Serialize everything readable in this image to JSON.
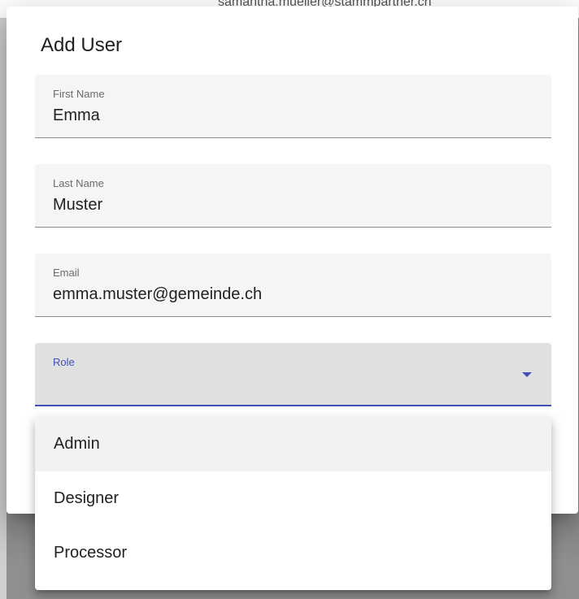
{
  "background": {
    "partial_text": "samantha.mueller@stammpartner.ch"
  },
  "dialog": {
    "title": "Add User",
    "fields": [
      {
        "label": "First Name",
        "value": "Emma"
      },
      {
        "label": "Last Name",
        "value": "Muster"
      },
      {
        "label": "Email",
        "value": "emma.muster@gemeinde.ch"
      }
    ],
    "role": {
      "label": "Role",
      "value": ""
    }
  },
  "role_menu": {
    "options": [
      "Admin",
      "Designer",
      "Processor"
    ],
    "highlighted": "Admin"
  },
  "colors": {
    "accent": "#3f51b5",
    "field_bg": "#f5f5f5",
    "focused_field_bg": "#e0e0e0",
    "backdrop": "#8f8f8f"
  }
}
